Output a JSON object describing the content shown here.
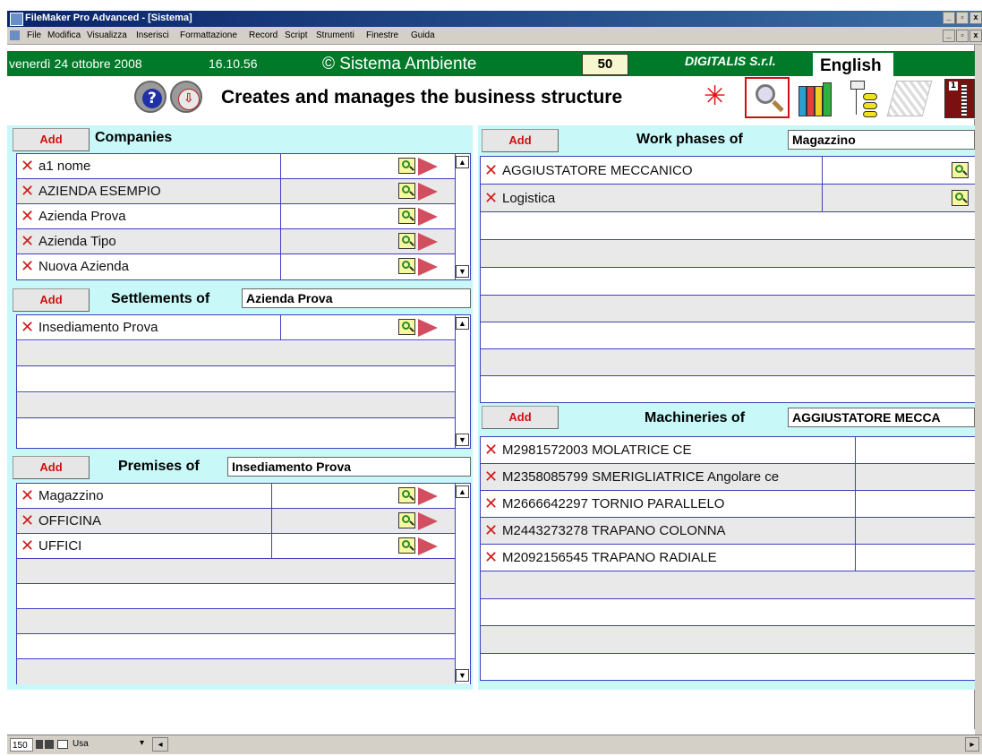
{
  "window": {
    "title": "FileMaker Pro Advanced - [Sistema]",
    "controls": [
      "_",
      "▫",
      "x"
    ]
  },
  "menu": [
    "File",
    "Modifica",
    "Visualizza",
    "Inserisci",
    "Formattazione",
    "Record",
    "Script",
    "Strumenti",
    "Finestre",
    "Guida"
  ],
  "header": {
    "date": "venerdì 24 ottobre 2008",
    "time": "16.10.56",
    "brand": "© Sistema Ambiente",
    "count": "50",
    "company": "DIGITALIS S.r.l.",
    "language": "English"
  },
  "page_title": "Creates and manages the business structure",
  "companies": {
    "add_label": "Add",
    "header": "Companies",
    "rows": [
      "a1 nome",
      "AZIENDA ESEMPIO",
      "Azienda Prova",
      "Azienda Tipo",
      "Nuova Azienda"
    ]
  },
  "settlements": {
    "add_label": "Add",
    "header": "Settlements of",
    "selected": "Azienda Prova",
    "rows": [
      "Insediamento Prova"
    ]
  },
  "premises": {
    "add_label": "Add",
    "header": "Premises of",
    "selected": "Insediamento Prova",
    "rows": [
      "Magazzino",
      "OFFICINA",
      "UFFICI"
    ]
  },
  "work_phases": {
    "add_label": "Add",
    "header": "Work phases of",
    "selected": "Magazzino",
    "rows": [
      "AGGIUSTATORE MECCANICO",
      "Logistica"
    ]
  },
  "machineries": {
    "add_label": "Add",
    "header": "Machineries of",
    "selected": "AGGIUSTATORE MECCA",
    "rows": [
      "M2981572003 MOLATRICE CE",
      "M2358085799 SMERIGLIATRICE Angolare ce",
      "M2666642297 TORNIO PARALLELO",
      "M2443273278 TRAPANO COLONNA",
      "M2092156545 TRAPANO RADIALE"
    ]
  },
  "statusbar": {
    "zoom": "150",
    "mode": "Usa"
  },
  "colors": {
    "green": "#007a28",
    "cyan": "#c8f8f8",
    "red": "#d01010",
    "blue_border": "#4040c0"
  }
}
